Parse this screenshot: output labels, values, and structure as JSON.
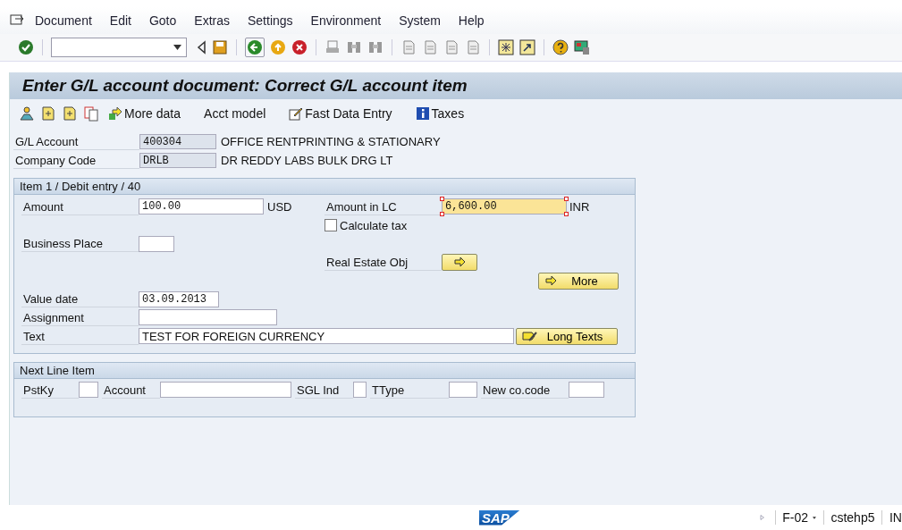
{
  "menu": [
    "Document",
    "Edit",
    "Goto",
    "Extras",
    "Settings",
    "Environment",
    "System",
    "Help"
  ],
  "title": "Enter G/L account document: Correct G/L account item",
  "app_toolbar": [
    {
      "kind": "icon"
    },
    {
      "kind": "icon"
    },
    {
      "kind": "icon"
    },
    {
      "kind": "icon"
    },
    {
      "kind": "text",
      "label": "More data"
    },
    {
      "kind": "text",
      "label": "Acct model"
    },
    {
      "kind": "text",
      "label": "Fast Data Entry"
    },
    {
      "kind": "text",
      "label": "Taxes"
    }
  ],
  "header": [
    {
      "label": "G/L Account",
      "value": "400304",
      "description": "OFFICE RENTPRINTING & STATIONARY"
    },
    {
      "label": "Company Code",
      "value": "DRLB",
      "description": "DR REDDY LABS BULK DRG LT"
    }
  ],
  "item": {
    "title": "Item 1 / Debit entry / 40",
    "amount": {
      "label": "Amount",
      "value": "100.00",
      "currency": "USD"
    },
    "amount_lc": {
      "label": "Amount in LC",
      "value": "6,600.00",
      "currency": "INR",
      "focused": true
    },
    "calculate_tax": {
      "label": "Calculate tax",
      "checked": false
    },
    "business_place": {
      "label": "Business Place"
    },
    "real_estate_obj": {
      "label": "Real Estate Obj"
    },
    "more_button": {
      "label": "More"
    },
    "value_date": {
      "label": "Value date",
      "value": "03.09.2013"
    },
    "assignment": {
      "label": "Assignment"
    },
    "text": {
      "label": "Text",
      "value": "TEST FOR FOREIGN CURRENCY"
    },
    "long_texts_button": {
      "label": "Long Texts"
    }
  },
  "next_line_item": {
    "title": "Next Line Item",
    "fields": [
      "PstKy",
      "Account",
      "SGL Ind",
      "TType",
      "New co.code"
    ]
  },
  "status_bar": {
    "logo": "SAP",
    "transaction": "F-02",
    "system": "cstehp5",
    "mode": "IN"
  }
}
